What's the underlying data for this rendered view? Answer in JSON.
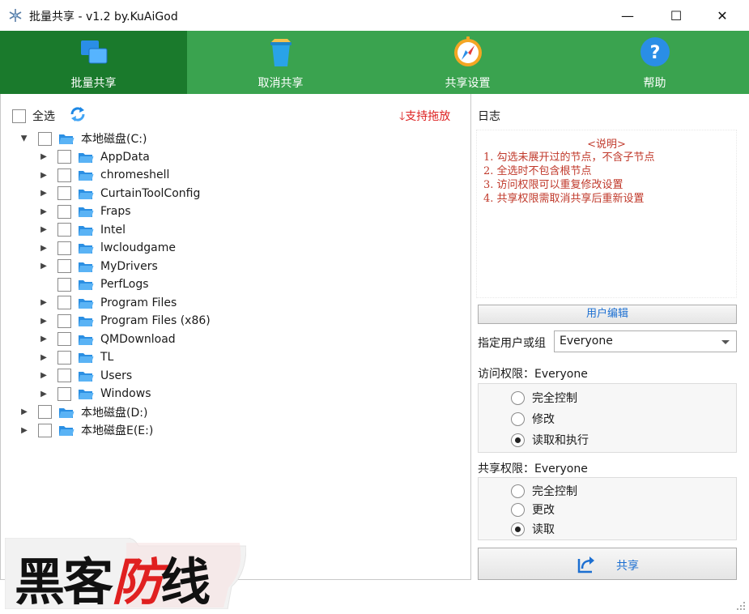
{
  "window": {
    "title": "批量共享 - v1.2 by.KuAiGod",
    "icon": "snowflake-icon",
    "controls": {
      "minimize": "—",
      "maximize": "☐",
      "close": "✕"
    }
  },
  "toolbar": {
    "accent": "#3aa34f",
    "active_color": "#1a7a2c",
    "items": [
      {
        "label": "批量共享",
        "icon": "windows-blocks-icon"
      },
      {
        "label": "取消共享",
        "icon": "trash-bin-icon"
      },
      {
        "label": "共享设置",
        "icon": "compass-icon"
      },
      {
        "label": "帮助",
        "icon": "help-icon"
      }
    ]
  },
  "left": {
    "select_all_label": "全选",
    "drag_hint": "🡓支持拖放",
    "tree": [
      {
        "label": "本地磁盘(C:)",
        "level": 0,
        "expanded": true
      },
      {
        "label": "AppData",
        "level": 1,
        "expanded": false
      },
      {
        "label": "chromeshell",
        "level": 1,
        "expanded": false
      },
      {
        "label": "CurtainToolConfig",
        "level": 1,
        "expanded": false
      },
      {
        "label": "Fraps",
        "level": 1,
        "expanded": false
      },
      {
        "label": "Intel",
        "level": 1,
        "expanded": false
      },
      {
        "label": "lwcloudgame",
        "level": 1,
        "expanded": false
      },
      {
        "label": "MyDrivers",
        "level": 1,
        "expanded": false
      },
      {
        "label": "PerfLogs",
        "level": 1,
        "leaf": true
      },
      {
        "label": "Program Files",
        "level": 1,
        "expanded": false
      },
      {
        "label": "Program Files (x86)",
        "level": 1,
        "expanded": false
      },
      {
        "label": "QMDownload",
        "level": 1,
        "expanded": false
      },
      {
        "label": "TL",
        "level": 1,
        "expanded": false
      },
      {
        "label": "Users",
        "level": 1,
        "expanded": false
      },
      {
        "label": "Windows",
        "level": 1,
        "expanded": false
      },
      {
        "label": "本地磁盘(D:)",
        "level": 0,
        "expanded": false
      },
      {
        "label": "本地磁盘E(E:)",
        "level": 0,
        "expanded": false
      }
    ]
  },
  "right": {
    "log_title": "日志",
    "notes_heading": "<说明>",
    "notes": [
      "1. 勾选未展开过的节点，不含子节点",
      "2. 全选时不包含根节点",
      "3. 访问权限可以重复修改设置",
      "4. 共享权限需取消共享后重新设置"
    ],
    "user_edit_label": "用户编辑",
    "user_label": "指定用户或组",
    "user_value": "Everyone",
    "access_title": "访问权限：Everyone",
    "access_options": [
      {
        "label": "完全控制",
        "selected": false
      },
      {
        "label": "修改",
        "selected": false
      },
      {
        "label": "读取和执行",
        "selected": true
      }
    ],
    "share_title": "共享权限：Everyone",
    "share_options": [
      {
        "label": "完全控制",
        "selected": false
      },
      {
        "label": "更改",
        "selected": false
      },
      {
        "label": "读取",
        "selected": true
      }
    ],
    "share_button_label": "共享"
  },
  "watermark": {
    "black": "黑客",
    "red": "防",
    "black2": "线"
  }
}
